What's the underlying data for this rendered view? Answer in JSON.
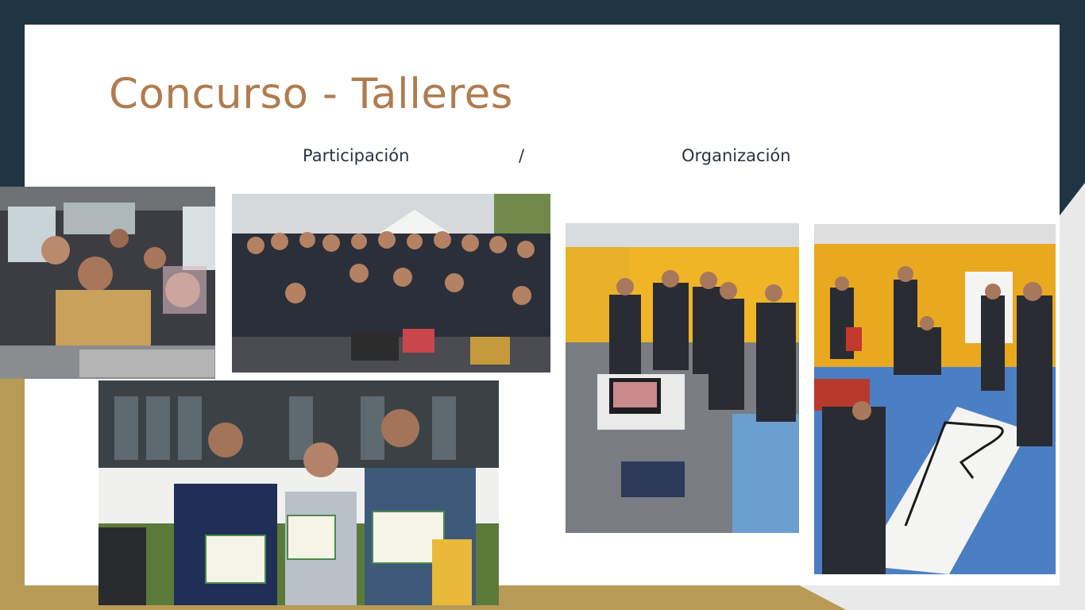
{
  "slide": {
    "title": "Concurso - Talleres",
    "subtitle_left": "Participación",
    "subtitle_separator": "/",
    "subtitle_right": "Organización"
  },
  "colors": {
    "frame": "#1f3541",
    "accent_gold": "#b89a57",
    "title": "#b07c4f",
    "slide_background": "#ffffff"
  },
  "photos": [
    {
      "subject": "students seated in a bus"
    },
    {
      "subject": "group photo of participants with robots"
    },
    {
      "subject": "three students holding certificates and a robot"
    },
    {
      "subject": "organizers at laptop station in workshop hall"
    },
    {
      "subject": "line-follower track being laid out on the floor"
    }
  ]
}
